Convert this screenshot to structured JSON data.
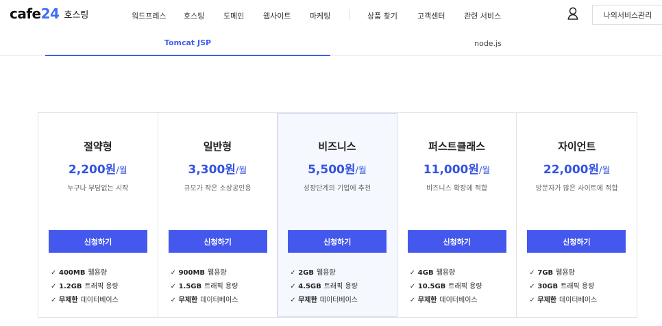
{
  "header": {
    "logo_mark": "cafe",
    "logo_num": "24",
    "logo_sub": "호스팅",
    "nav": [
      "워드프레스",
      "호스팅",
      "도메인",
      "웹사이트",
      "마케팅",
      "상품 찾기",
      "고객센터",
      "관련 서비스"
    ],
    "account_button": "나의서비스관리",
    "user_icon": "user-icon"
  },
  "tabs": [
    {
      "label": "Tomcat JSP",
      "active": true
    },
    {
      "label": "node.js",
      "active": false
    }
  ],
  "colors": {
    "accent": "#3f5ef0",
    "button": "#4458ee",
    "price": "#3553e0",
    "featured_bg": "#f5f8ff"
  },
  "plans": [
    {
      "name": "절약형",
      "price": "2,200원",
      "unit": "/월",
      "desc": "누구나 부담없는 시작",
      "button": "신청하기",
      "features": [
        {
          "bold": "400MB",
          "text": "웹용량"
        },
        {
          "bold": "1.2GB",
          "text": "트래픽 용량"
        },
        {
          "bold": "무제한",
          "text": "데이터베이스"
        }
      ]
    },
    {
      "name": "일반형",
      "price": "3,300원",
      "unit": "/월",
      "desc": "규모가 작은 소상공인용",
      "button": "신청하기",
      "features": [
        {
          "bold": "900MB",
          "text": "웹용량"
        },
        {
          "bold": "1.5GB",
          "text": "트래픽 용량"
        },
        {
          "bold": "무제한",
          "text": "데이터베이스"
        }
      ]
    },
    {
      "name": "비즈니스",
      "price": "5,500원",
      "unit": "/월",
      "desc": "성장단계의 기업에 추천",
      "button": "신청하기",
      "featured": true,
      "features": [
        {
          "bold": "2GB",
          "text": "웹용량"
        },
        {
          "bold": "4.5GB",
          "text": "트래픽 용량"
        },
        {
          "bold": "무제한",
          "text": "데이터베이스"
        }
      ]
    },
    {
      "name": "퍼스트클래스",
      "price": "11,000원",
      "unit": "/월",
      "desc": "비즈니스 확장에 적합",
      "button": "신청하기",
      "features": [
        {
          "bold": "4GB",
          "text": "웹용량"
        },
        {
          "bold": "10.5GB",
          "text": "트래픽 용량"
        },
        {
          "bold": "무제한",
          "text": "데이터베이스"
        }
      ]
    },
    {
      "name": "자이언트",
      "price": "22,000원",
      "unit": "/월",
      "desc": "방문자가 많은 사이트에 적합",
      "button": "신청하기",
      "features": [
        {
          "bold": "7GB",
          "text": "웹용량"
        },
        {
          "bold": "30GB",
          "text": "트래픽 용량"
        },
        {
          "bold": "무제한",
          "text": "데이터베이스"
        }
      ]
    }
  ]
}
